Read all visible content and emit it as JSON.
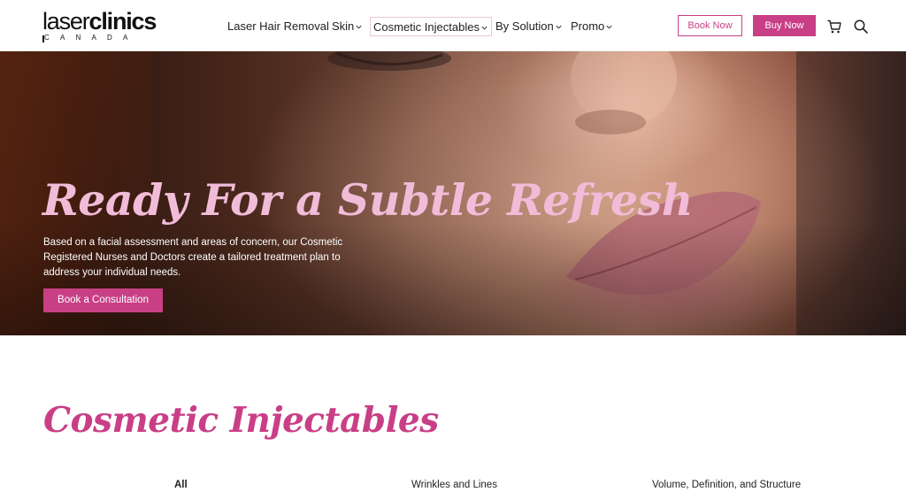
{
  "header": {
    "logo": {
      "part1": "laser",
      "part2": "clinics",
      "sub": "CANADA"
    },
    "nav": [
      {
        "label": "Laser Hair Removal"
      },
      {
        "label": "Skin"
      },
      {
        "label": "Cosmetic Injectables"
      },
      {
        "label": "By Solution"
      },
      {
        "label": "Promo"
      }
    ],
    "book_now": "Book Now",
    "buy_now": "Buy Now",
    "icons": [
      "cart-icon",
      "search-icon"
    ]
  },
  "hero": {
    "title": "Ready For a Subtle Refresh",
    "text": "Based on a facial assessment and areas of concern, our Cosmetic Registered Nurses and Doctors create a tailored treatment plan to address your individual needs.",
    "cta": "Book a Consultation"
  },
  "section": {
    "title": "Cosmetic Injectables",
    "filters": [
      {
        "label": "All",
        "active": true
      },
      {
        "label": "Wrinkles and Lines",
        "active": false
      },
      {
        "label": "Volume, Definition, and Structure",
        "active": false
      }
    ]
  },
  "colors": {
    "accent": "#c93f86",
    "hero_title": "#f1bcd8"
  }
}
